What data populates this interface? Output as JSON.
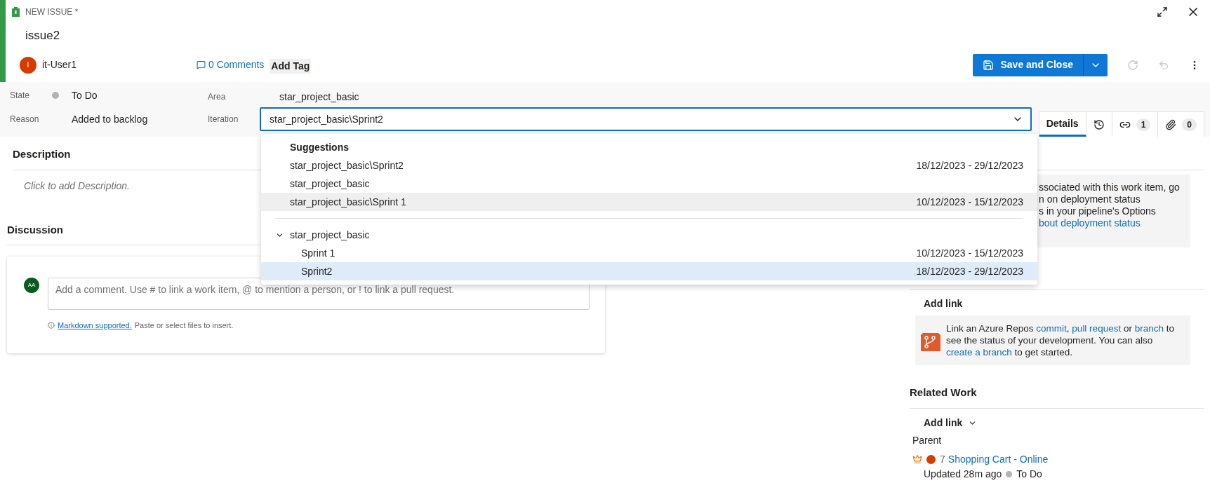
{
  "header": {
    "kind_label": "NEW ISSUE *",
    "title": "issue2",
    "assignee": {
      "initial": "I",
      "name": "it-User1"
    },
    "comments": "0 Comments",
    "add_tag": "Add Tag",
    "save_button": "Save and Close"
  },
  "fields": {
    "state": {
      "label": "State",
      "value": "To Do"
    },
    "reason": {
      "label": "Reason",
      "value": "Added to backlog"
    },
    "area": {
      "label": "Area",
      "value": "star_project_basic"
    },
    "iteration": {
      "label": "Iteration",
      "value": "star_project_basic\\Sprint2"
    }
  },
  "tabs": [
    {
      "kind": "text",
      "label": "Details",
      "selected": true
    },
    {
      "kind": "history",
      "selected": false
    },
    {
      "kind": "links",
      "count": "1",
      "selected": false
    },
    {
      "kind": "attachments",
      "count": "0",
      "selected": false
    }
  ],
  "dropdown": {
    "heading": "Suggestions",
    "suggestions": [
      {
        "path": "star_project_basic\\Sprint2",
        "dates": "18/12/2023 - 29/12/2023",
        "hovered": false
      },
      {
        "path": "star_project_basic",
        "hovered": false
      },
      {
        "path": "star_project_basic\\Sprint 1",
        "dates": "10/12/2023 - 15/12/2023",
        "hovered": true
      }
    ],
    "tree": {
      "label": "star_project_basic",
      "expanded": true,
      "children": [
        {
          "label": "Sprint 1",
          "dates": "10/12/2023 - 15/12/2023",
          "selected": false
        },
        {
          "label": "Sprint2",
          "dates": "18/12/2023 - 29/12/2023",
          "selected": true
        }
      ]
    }
  },
  "description": {
    "title": "Description",
    "placeholder": "Click to add Description."
  },
  "discussion": {
    "title": "Discussion",
    "avatar": "AA",
    "placeholder": "Add a comment. Use # to link a work item, @ to mention a person, or ! to link a pull request.",
    "markdown_link": "Markdown supported.",
    "hint": "Paste or select files to insert."
  },
  "deployment": {
    "lines": [
      "ssociated with this work item, go",
      "n on deployment status",
      "s in your pipeline's Options"
    ],
    "link": "bout deployment status"
  },
  "development": {
    "add_link": "Add link",
    "segments": [
      {
        "kind": "text",
        "text": "Link an Azure Repos "
      },
      {
        "kind": "link",
        "text": "commit"
      },
      {
        "kind": "text",
        "text": ", "
      },
      {
        "kind": "link",
        "text": "pull request"
      },
      {
        "kind": "text",
        "text": " or "
      },
      {
        "kind": "link",
        "text": "branch"
      },
      {
        "kind": "text",
        "text": " to see the status of your development. You can also "
      },
      {
        "kind": "link",
        "text": "create a branch"
      },
      {
        "kind": "text",
        "text": " to get started."
      }
    ]
  },
  "related": {
    "title": "Related Work",
    "add_link": "Add link",
    "group": "Parent",
    "items": [
      {
        "id": "7",
        "title": "Shopping Cart - Online",
        "updated": "Updated 28m ago",
        "state": "To Do"
      }
    ]
  }
}
